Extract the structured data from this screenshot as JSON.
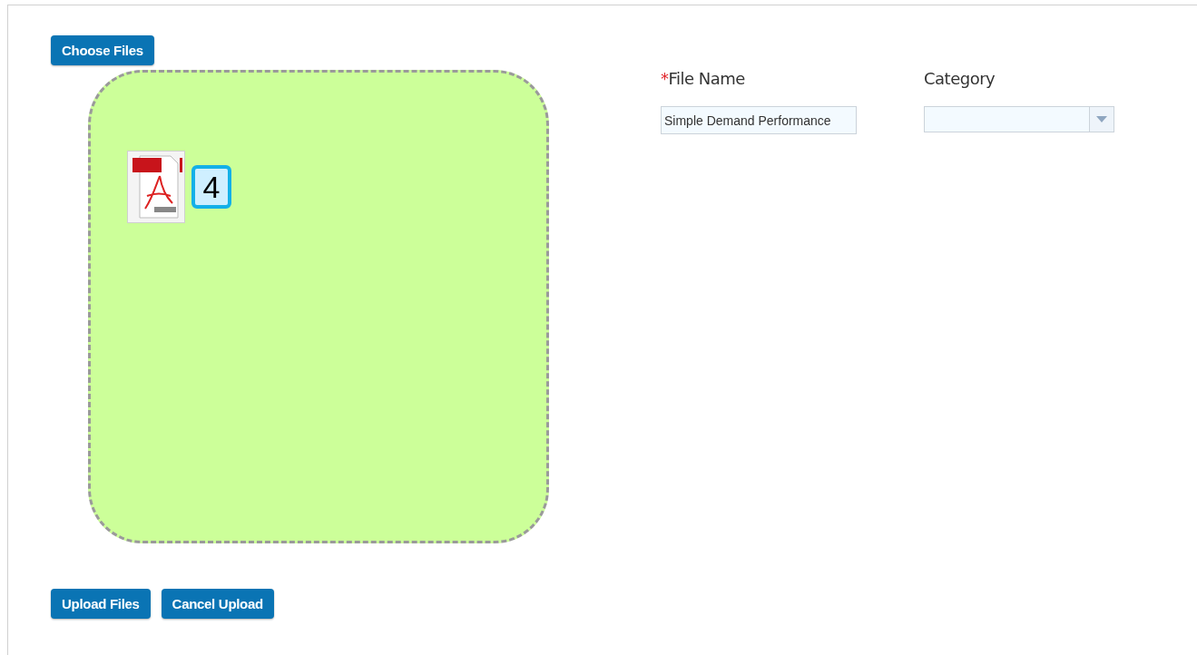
{
  "choose_button": "Choose Files",
  "dropzone": {
    "files": [
      {
        "kind": "pdf",
        "badge": "4"
      }
    ]
  },
  "fields": [
    {
      "kind": "text",
      "required_mark": "*",
      "label": "File Name",
      "value": "Simple Demand Performance"
    },
    {
      "kind": "select",
      "label": "Category"
    }
  ],
  "buttons": [
    "Upload Files",
    "Cancel Upload"
  ]
}
